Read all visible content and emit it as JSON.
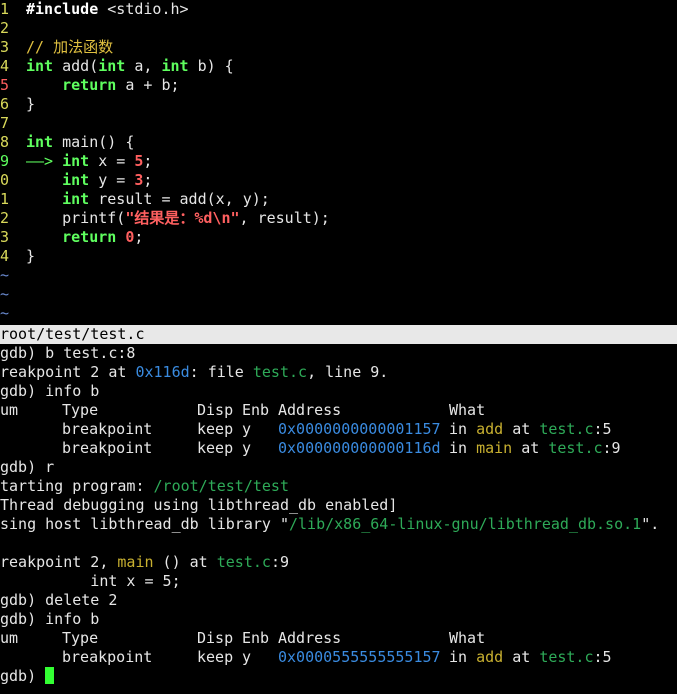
{
  "source": {
    "lines": [
      {
        "num": "1",
        "parts": [
          [
            "pp",
            "#include"
          ],
          [
            "",
            " <stdio.h>"
          ]
        ]
      },
      {
        "num": "2",
        "parts": []
      },
      {
        "num": "3",
        "parts": [
          [
            "cm",
            "// 加法函数"
          ]
        ]
      },
      {
        "num": "4",
        "parts": [
          [
            "kw",
            "int"
          ],
          [
            "",
            " add("
          ],
          [
            "kw",
            "int"
          ],
          [
            "",
            " a, "
          ],
          [
            "kw",
            "int"
          ],
          [
            "",
            " b) {"
          ]
        ]
      },
      {
        "num": "5",
        "parts": [
          [
            "",
            "    "
          ],
          [
            "kw",
            "return"
          ],
          [
            "",
            " a + b;"
          ]
        ],
        "mark": "breakpoint"
      },
      {
        "num": "6",
        "parts": [
          [
            "",
            "}"
          ]
        ]
      },
      {
        "num": "7",
        "parts": []
      },
      {
        "num": "8",
        "parts": [
          [
            "kw",
            "int"
          ],
          [
            "",
            " main() {"
          ]
        ]
      },
      {
        "num": "9",
        "parts": [
          [
            "kw",
            "int"
          ],
          [
            "",
            " x = "
          ],
          [
            "num",
            "5"
          ],
          [
            "",
            ";"
          ]
        ],
        "mark": "current",
        "arrow": "——> "
      },
      {
        "num": "0",
        "parts": [
          [
            "",
            "    "
          ],
          [
            "kw",
            "int"
          ],
          [
            "",
            " y = "
          ],
          [
            "num",
            "3"
          ],
          [
            "",
            ";"
          ]
        ]
      },
      {
        "num": "1",
        "parts": [
          [
            "",
            "    "
          ],
          [
            "kw",
            "int"
          ],
          [
            "",
            " result = add(x, y);"
          ]
        ]
      },
      {
        "num": "2",
        "parts": [
          [
            "",
            "    printf("
          ],
          [
            "str",
            "\"结果是：%d\\n\""
          ],
          [
            "",
            ", result);"
          ]
        ]
      },
      {
        "num": "3",
        "parts": [
          [
            "",
            "    "
          ],
          [
            "kw",
            "return"
          ],
          [
            "",
            " "
          ],
          [
            "num",
            "0"
          ],
          [
            "",
            ";"
          ]
        ]
      },
      {
        "num": "4",
        "parts": [
          [
            "",
            "}"
          ]
        ]
      }
    ],
    "tildes": [
      "~",
      "~",
      "~"
    ]
  },
  "status_bar": {
    "filename": "root/test/test.c"
  },
  "console": {
    "l1": "gdb) b test.c:8",
    "l2": {
      "a": "reakpoint 2 at ",
      "addr": "0x116d",
      "b": ": file ",
      "file": "test.c",
      "c": ", line 9."
    },
    "l3": "gdb) info b",
    "table1_header": {
      "num": "um",
      "type": "Type",
      "disp": "Disp",
      "enb": "Enb",
      "address": "Address",
      "what": "What"
    },
    "table1_rows": [
      {
        "type": "breakpoint",
        "disp": "keep",
        "enb": "y",
        "address": "0x0000000000001157",
        "in": "in ",
        "func": "add",
        "at": " at ",
        "file": "test.c",
        "line": ":5"
      },
      {
        "type": "breakpoint",
        "disp": "keep",
        "enb": "y",
        "address": "0x000000000000116d",
        "in": "in ",
        "func": "main",
        "at": " at ",
        "file": "test.c",
        "line": ":9"
      }
    ],
    "l6": "gdb) r",
    "l7": {
      "a": "tarting program: ",
      "path": "/root/test/test"
    },
    "l8": "Thread debugging using libthread_db enabled]",
    "l9": {
      "a": "sing host libthread_db library \"",
      "path": "/lib/x86_64-linux-gnu/libthread_db.so.1",
      "b": "\"."
    },
    "l11": {
      "a": "reakpoint 2, ",
      "func": "main",
      "b": " () at ",
      "file": "test.c",
      "c": ":9"
    },
    "l12": "          int x = 5;",
    "l13": "gdb) delete 2",
    "l14": "gdb) info b",
    "table2_header": {
      "num": "um",
      "type": "Type",
      "disp": "Disp",
      "enb": "Enb",
      "address": "Address",
      "what": "What"
    },
    "table2_rows": [
      {
        "type": "breakpoint",
        "disp": "keep",
        "enb": "y",
        "address": "0x0000555555555157",
        "in": "in ",
        "func": "add",
        "at": " at ",
        "file": "test.c",
        "line": ":5"
      }
    ],
    "prompt": "gdb) "
  },
  "colors": {
    "background": "#000000",
    "keyword": "#5fff5f",
    "address": "#3a8be0",
    "file": "#2eaa58",
    "function": "#c8b030",
    "cursor": "#33ff33"
  }
}
